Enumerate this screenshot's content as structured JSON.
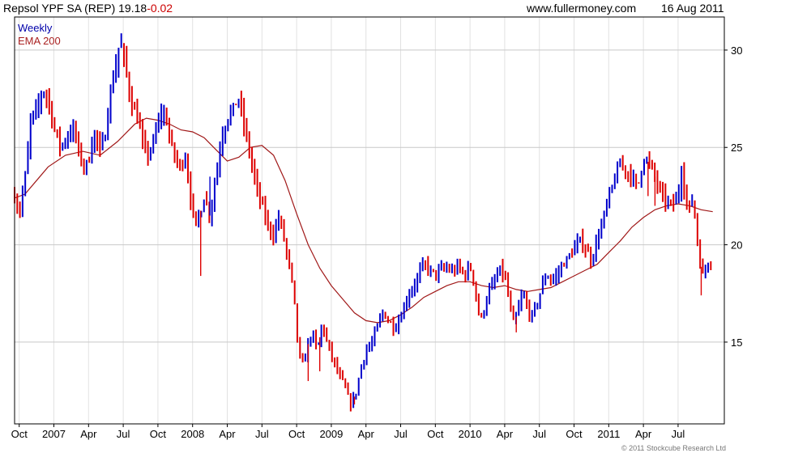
{
  "header": {
    "symbol": "Repsol YPF SA (REP)",
    "price": "19.18",
    "change": "-0.02",
    "site": "www.fullermoney.com",
    "date": "16 Aug 2011"
  },
  "copyright": "© 2011 Stockcube Research Ltd",
  "colors": {
    "up_bar": "#0000cc",
    "down_bar": "#dd0000",
    "ema": "#a01818",
    "grid": "#c8c8c8",
    "frame": "#000000"
  },
  "chart_data": {
    "type": "line",
    "style": "weekly ohlc bars with moving average overlay",
    "legend": [
      "Weekly",
      "EMA 200"
    ],
    "legend_colors": [
      "#0000aa",
      "#aa2222"
    ],
    "legend_position": "top-left",
    "x_tick_labels": [
      "Oct",
      "2007",
      "Apr",
      "Jul",
      "Oct",
      "2008",
      "Apr",
      "Jul",
      "Oct",
      "2009",
      "Apr",
      "Jul",
      "Oct",
      "2010",
      "Apr",
      "Jul",
      "Oct",
      "2011",
      "Apr",
      "Jul"
    ],
    "x_tick_months": [
      4,
      7,
      10,
      13,
      16,
      19,
      22,
      25,
      28,
      31,
      34,
      37,
      40,
      43,
      46,
      49,
      52,
      55,
      58,
      61
    ],
    "x_range_months": [
      3.6,
      65.0
    ],
    "ylim": [
      10.8,
      31.7
    ],
    "y_ticks": [
      15,
      20,
      25,
      30
    ],
    "y_axis_side": "right",
    "grid": true,
    "price_path": [
      [
        3.6,
        22.5
      ],
      [
        4.0,
        21.6
      ],
      [
        4.6,
        23.8
      ],
      [
        5.0,
        26.5
      ],
      [
        5.6,
        27.0
      ],
      [
        6.0,
        28.0
      ],
      [
        6.5,
        27.5
      ],
      [
        7.0,
        26.0
      ],
      [
        7.6,
        25.0
      ],
      [
        8.2,
        25.6
      ],
      [
        8.8,
        26.0
      ],
      [
        9.2,
        24.5
      ],
      [
        9.7,
        24.0
      ],
      [
        10.0,
        24.3
      ],
      [
        10.5,
        25.8
      ],
      [
        11.0,
        24.8
      ],
      [
        11.4,
        25.5
      ],
      [
        11.8,
        27.5
      ],
      [
        12.3,
        29.0
      ],
      [
        12.7,
        30.5
      ],
      [
        13.1,
        29.5
      ],
      [
        13.6,
        27.5
      ],
      [
        14.2,
        26.5
      ],
      [
        14.6,
        25.5
      ],
      [
        15.0,
        24.5
      ],
      [
        15.6,
        25.2
      ],
      [
        16.2,
        26.8
      ],
      [
        16.7,
        26.5
      ],
      [
        17.2,
        25.0
      ],
      [
        17.8,
        24.0
      ],
      [
        18.4,
        24.5
      ],
      [
        18.8,
        22.5
      ],
      [
        19.2,
        21.0
      ],
      [
        19.6,
        21.5
      ],
      [
        20.0,
        22.5
      ],
      [
        20.5,
        21.5
      ],
      [
        21.0,
        23.5
      ],
      [
        21.5,
        25.5
      ],
      [
        22.0,
        26.5
      ],
      [
        22.5,
        27.0
      ],
      [
        23.0,
        27.5
      ],
      [
        23.5,
        26.0
      ],
      [
        24.0,
        24.5
      ],
      [
        24.5,
        23.0
      ],
      [
        25.0,
        22.0
      ],
      [
        25.5,
        21.0
      ],
      [
        26.0,
        20.5
      ],
      [
        26.5,
        21.5
      ],
      [
        27.0,
        20.0
      ],
      [
        27.5,
        18.5
      ],
      [
        27.8,
        17.0
      ],
      [
        28.1,
        15.0
      ],
      [
        28.4,
        13.5
      ],
      [
        28.8,
        14.5
      ],
      [
        29.3,
        15.5
      ],
      [
        29.8,
        14.5
      ],
      [
        30.2,
        16.0
      ],
      [
        30.7,
        14.8
      ],
      [
        31.2,
        14.0
      ],
      [
        31.7,
        13.2
      ],
      [
        32.1,
        12.8
      ],
      [
        32.5,
        12.0
      ],
      [
        32.8,
        11.8
      ],
      [
        33.2,
        12.6
      ],
      [
        33.6,
        13.8
      ],
      [
        34.0,
        14.6
      ],
      [
        34.5,
        14.9
      ],
      [
        35.0,
        15.8
      ],
      [
        35.5,
        16.6
      ],
      [
        36.0,
        16.0
      ],
      [
        36.5,
        15.8
      ],
      [
        37.0,
        16.3
      ],
      [
        37.5,
        17.2
      ],
      [
        38.0,
        17.8
      ],
      [
        38.4,
        18.2
      ],
      [
        38.8,
        18.8
      ],
      [
        39.2,
        19.0
      ],
      [
        39.6,
        18.6
      ],
      [
        40.0,
        18.5
      ],
      [
        40.5,
        18.7
      ],
      [
        41.0,
        18.8
      ],
      [
        41.5,
        18.6
      ],
      [
        42.0,
        18.9
      ],
      [
        42.5,
        18.4
      ],
      [
        43.0,
        18.9
      ],
      [
        43.4,
        18.0
      ],
      [
        43.7,
        16.5
      ],
      [
        44.0,
        16.2
      ],
      [
        44.4,
        17.2
      ],
      [
        44.8,
        17.8
      ],
      [
        45.2,
        18.2
      ],
      [
        45.6,
        18.7
      ],
      [
        46.0,
        18.4
      ],
      [
        46.4,
        17.0
      ],
      [
        46.8,
        15.8
      ],
      [
        47.2,
        16.8
      ],
      [
        47.6,
        17.5
      ],
      [
        48.0,
        16.6
      ],
      [
        48.4,
        16.3
      ],
      [
        48.8,
        17.0
      ],
      [
        49.2,
        17.8
      ],
      [
        49.6,
        18.5
      ],
      [
        50.0,
        18.2
      ],
      [
        50.5,
        18.4
      ],
      [
        51.0,
        19.0
      ],
      [
        51.5,
        19.3
      ],
      [
        52.0,
        19.8
      ],
      [
        52.5,
        20.2
      ],
      [
        53.0,
        19.8
      ],
      [
        53.5,
        19.2
      ],
      [
        54.0,
        20.3
      ],
      [
        54.4,
        21.0
      ],
      [
        54.8,
        22.0
      ],
      [
        55.2,
        22.8
      ],
      [
        55.6,
        23.5
      ],
      [
        56.0,
        24.2
      ],
      [
        56.5,
        23.8
      ],
      [
        57.0,
        23.5
      ],
      [
        57.5,
        22.9
      ],
      [
        58.0,
        24.5
      ],
      [
        58.5,
        24.2
      ],
      [
        59.0,
        23.5
      ],
      [
        59.5,
        22.6
      ],
      [
        60.0,
        22.2
      ],
      [
        60.5,
        22.0
      ],
      [
        61.0,
        22.5
      ],
      [
        61.3,
        24.0
      ],
      [
        61.6,
        22.5
      ],
      [
        62.0,
        21.8
      ],
      [
        62.3,
        22.5
      ],
      [
        62.6,
        20.5
      ],
      [
        62.9,
        19.2
      ],
      [
        63.2,
        18.2
      ],
      [
        63.5,
        19.2
      ],
      [
        64.0,
        19.18
      ]
    ],
    "ema_path": [
      [
        3.6,
        22.4
      ],
      [
        4.5,
        22.6
      ],
      [
        5.5,
        23.3
      ],
      [
        6.5,
        24.0
      ],
      [
        8.0,
        24.6
      ],
      [
        9.5,
        24.8
      ],
      [
        11.0,
        24.6
      ],
      [
        12.5,
        25.3
      ],
      [
        14.0,
        26.2
      ],
      [
        15.0,
        26.5
      ],
      [
        16.0,
        26.4
      ],
      [
        17.0,
        26.2
      ],
      [
        18.0,
        25.9
      ],
      [
        19.0,
        25.8
      ],
      [
        20.0,
        25.5
      ],
      [
        21.0,
        24.9
      ],
      [
        22.0,
        24.3
      ],
      [
        23.0,
        24.5
      ],
      [
        24.0,
        25.0
      ],
      [
        25.0,
        25.1
      ],
      [
        26.0,
        24.6
      ],
      [
        27.0,
        23.3
      ],
      [
        28.0,
        21.6
      ],
      [
        29.0,
        20.0
      ],
      [
        30.0,
        18.8
      ],
      [
        31.0,
        17.9
      ],
      [
        32.0,
        17.2
      ],
      [
        33.0,
        16.5
      ],
      [
        34.0,
        16.1
      ],
      [
        35.0,
        16.0
      ],
      [
        36.0,
        16.1
      ],
      [
        37.0,
        16.4
      ],
      [
        38.0,
        16.8
      ],
      [
        39.0,
        17.3
      ],
      [
        40.0,
        17.6
      ],
      [
        41.0,
        17.9
      ],
      [
        42.0,
        18.1
      ],
      [
        43.0,
        18.1
      ],
      [
        44.0,
        17.9
      ],
      [
        45.0,
        17.8
      ],
      [
        46.0,
        17.9
      ],
      [
        47.0,
        17.7
      ],
      [
        48.0,
        17.6
      ],
      [
        49.0,
        17.7
      ],
      [
        50.0,
        17.8
      ],
      [
        51.0,
        18.1
      ],
      [
        52.0,
        18.4
      ],
      [
        53.0,
        18.7
      ],
      [
        54.0,
        19.0
      ],
      [
        55.0,
        19.6
      ],
      [
        56.0,
        20.2
      ],
      [
        57.0,
        20.9
      ],
      [
        58.0,
        21.4
      ],
      [
        59.0,
        21.8
      ],
      [
        60.0,
        22.0
      ],
      [
        61.0,
        22.1
      ],
      [
        62.0,
        22.0
      ],
      [
        63.0,
        21.8
      ],
      [
        64.0,
        21.7
      ]
    ],
    "wicks": [
      [
        19.7,
        18.4
      ],
      [
        20.5,
        23.5
      ],
      [
        29.0,
        13.0
      ],
      [
        30.0,
        13.5
      ],
      [
        33.0,
        11.8
      ],
      [
        47.0,
        15.5
      ],
      [
        58.4,
        22.5
      ],
      [
        59.0,
        22.0
      ],
      [
        63.0,
        17.4
      ]
    ]
  }
}
